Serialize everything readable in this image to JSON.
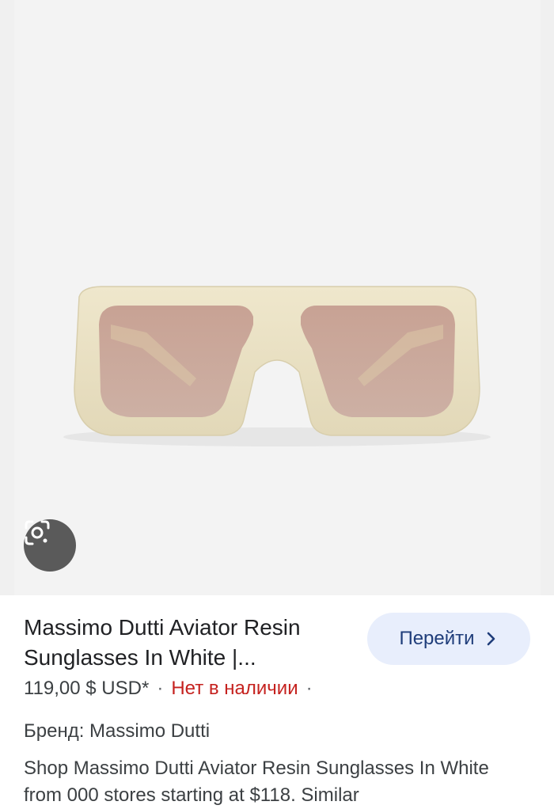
{
  "product": {
    "title": "Massimo Dutti Aviator Resin Sunglasses In White |...",
    "go_button_label": "Перейти",
    "price": "119,00 $ USD*",
    "stock_status": "Нет в наличии",
    "separator": "·",
    "brand_line": "Бренд: Massimo Dutti",
    "description": "Shop Massimo Dutti Aviator Resin Sunglasses In White from 000 stores starting at $118. Similar"
  },
  "icons": {
    "lens": "google-lens-icon",
    "chevron": "chevron-right-icon"
  },
  "colors": {
    "go_button_bg": "#e8eefc",
    "stock_red": "#c5221f",
    "frame": "#ebe2c4",
    "lens_tint": "#c9a79b"
  }
}
